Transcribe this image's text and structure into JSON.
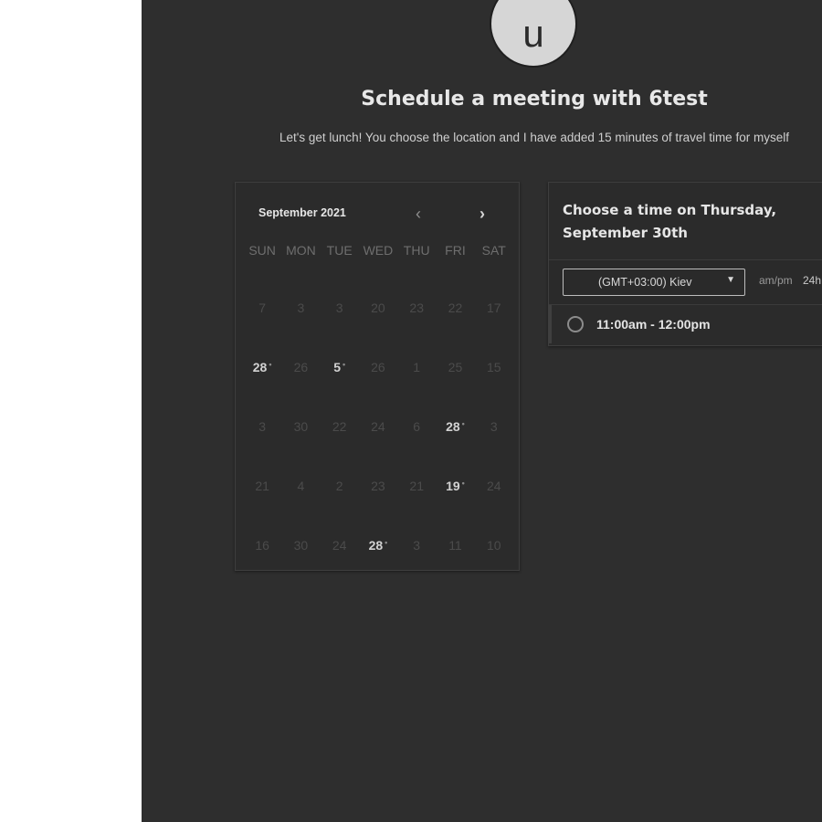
{
  "avatar": {
    "initial": "u"
  },
  "header": {
    "title": "Schedule a meeting with 6test",
    "description": "Let's get lunch! You choose the location and I have added 15 minutes of travel time for myself"
  },
  "calendar": {
    "month_label": "September 2021",
    "prev_icon": "chevron-left-icon",
    "next_icon": "chevron-right-icon",
    "weekdays": [
      "SUN",
      "MON",
      "TUE",
      "WED",
      "THU",
      "FRI",
      "SAT"
    ],
    "weeks": [
      [
        "7",
        "3",
        "3",
        "20",
        "23",
        "22",
        "17"
      ],
      [
        "28",
        "26",
        "5",
        "26",
        "1",
        "25",
        "15"
      ],
      [
        "3",
        "30",
        "22",
        "24",
        "6",
        "28",
        "3"
      ],
      [
        "21",
        "4",
        "2",
        "23",
        "21",
        "19",
        "24"
      ],
      [
        "16",
        "30",
        "24",
        "28",
        "3",
        "11",
        "10"
      ]
    ],
    "available": [
      [
        1,
        0
      ],
      [
        1,
        2
      ],
      [
        2,
        5
      ],
      [
        3,
        5
      ],
      [
        4,
        3
      ]
    ]
  },
  "times": {
    "heading": "Choose a time on Thursday, September 30th",
    "timezone": "(GMT+03:00) Kiev",
    "format_ampm": "am/pm",
    "format_24h": "24h",
    "slots": [
      "11:00am - 12:00pm"
    ]
  },
  "colors": {
    "panel_bg": "#2e2e2e",
    "card_bg": "#2b2b2b",
    "text_primary": "#e6e6e6",
    "text_muted": "#4b4b4b"
  }
}
